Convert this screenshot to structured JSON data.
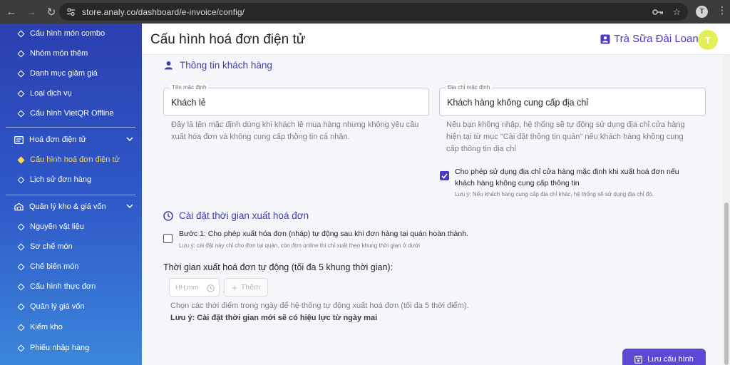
{
  "browser": {
    "url": "store.analy.co/dashboard/e-invoice/config/",
    "profile_initial": "T"
  },
  "sidebar": {
    "top_items": [
      {
        "label": "Cấu hình món combo"
      },
      {
        "label": "Nhóm món thêm"
      },
      {
        "label": "Danh mục giảm giá"
      },
      {
        "label": "Loại dịch vụ"
      },
      {
        "label": "Cấu hình VietQR Offline"
      }
    ],
    "invoice_group": {
      "label": "Hoá đơn điện tử",
      "items": [
        {
          "label": "Cấu hình hoá đơn điện tử",
          "active": true
        },
        {
          "label": "Lịch sử đơn hàng"
        }
      ]
    },
    "inventory_group": {
      "label": "Quản lý kho & giá vốn",
      "items": [
        {
          "label": "Nguyên vật liệu"
        },
        {
          "label": "Sơ chế món"
        },
        {
          "label": "Chế biến món"
        },
        {
          "label": "Cấu hình thực đơn"
        },
        {
          "label": "Quản lý giá vốn"
        },
        {
          "label": "Kiểm kho"
        },
        {
          "label": "Phiếu nhập hàng"
        }
      ]
    }
  },
  "header": {
    "title": "Cấu hình hoá đơn điện tử",
    "store_name": "Trà Sữa Đài Loan",
    "avatar_initial": "T"
  },
  "customer_section": {
    "title": "Thông tin khách hàng",
    "default_name": {
      "label": "Tên mặc định",
      "value": "Khách lẻ",
      "help": "Đây là tên mặc định dùng khi khách lẻ mua hàng nhưng không yêu cầu xuất hóa đơn và không cung cấp thông tin cá nhân."
    },
    "default_address": {
      "label": "Địa chỉ mặc định",
      "value": "Khách hàng không cung cấp địa chỉ",
      "help": "Nếu bạn không nhập, hệ thống sẽ tự động sử dụng địa chỉ cửa hàng hiện tại từ mục \"Cài đặt thông tin quán\" nếu khách hàng không cung cấp thông tin địa chỉ"
    },
    "use_store_address": {
      "checked": true,
      "label": "Cho phép sử dụng địa chỉ cửa hàng mặc định khi xuất hoá đơn nếu khách hàng không cung cấp thông tin",
      "note": "Lưu ý: Nếu khách hàng cung cấp địa chỉ khác, hệ thống sẽ sử dụng địa chỉ đó."
    }
  },
  "time_section": {
    "title": "Cài đặt thời gian xuất hoá đơn",
    "step1": {
      "checked": false,
      "label": "Bước 1: Cho phép xuất hóa đơn (nháp) tự động sau khi đơn hàng tại quán hoàn thành.",
      "note": "Lưu ý: cài đặt này chỉ cho đơn tại quán, còn đơn online thì chỉ xuất theo khung thời gian ở dưới"
    },
    "auto_time_label": "Thời gian xuất hoá đơn tự động (tối đa 5 khung thời gian):",
    "time_placeholder": "HH:mm",
    "add_label": "Thêm",
    "help": "Chọn các thời điểm trong ngày để hệ thống tự động xuất hoá đơn (tối đa 5 thời điểm).",
    "note": "Lưu ý: Cài đặt thời gian mới sẽ có hiệu lực từ ngày mai"
  },
  "save_label": "Lưu cấu hình"
}
